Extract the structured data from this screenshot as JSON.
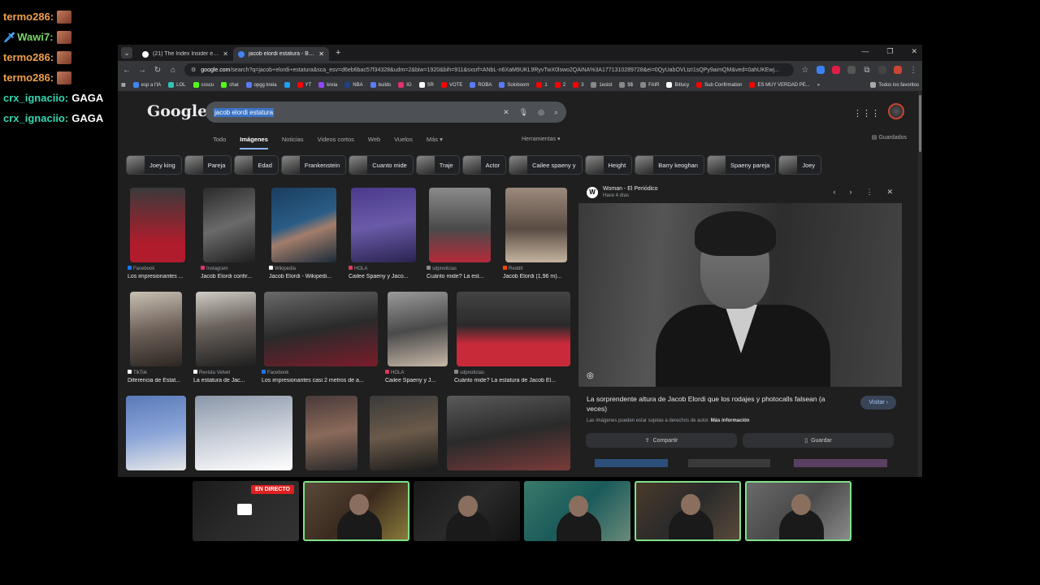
{
  "chat": [
    {
      "user": "termo286:",
      "color": "#f0a04b",
      "msg": ""
    },
    {
      "user": "Wawi7:",
      "color": "#7dd36b",
      "msg": "",
      "badge": "sword-icon"
    },
    {
      "user": "termo286:",
      "color": "#f0a04b",
      "msg": ""
    },
    {
      "user": "termo286:",
      "color": "#f0a04b",
      "msg": ""
    },
    {
      "user": "crx_ignaciio:",
      "color": "#33d6b0",
      "msg": "GAGA"
    },
    {
      "user": "crx_ignaciio:",
      "color": "#33d6b0",
      "msg": "GAGA"
    }
  ],
  "browser": {
    "tabs": [
      {
        "title": "(21) The Index Insider en X: \"Ir...",
        "favicon_color": "#ffffff",
        "active": false
      },
      {
        "title": "jacob elordi estatura - Buscar co...",
        "favicon_color": "#4285f4",
        "active": true
      }
    ],
    "url_host": "google.com",
    "url_rest": "/search?q=jacob+elordi+estatura&sca_esv=d6eb6bac57f34328&udm=2&biw=1920&bih=911&sxsrf=ANbL-n6XaM9UKL9RyvTwX0lswo2QAiNA%3A1771310289728&ei=0QyUabOVLtzI1sQPy9aimQM&ved=0ahUKEwj...",
    "bookmarks": [
      {
        "label": "esp a l'IA",
        "color": "#4285f4"
      },
      {
        "label": "LOL",
        "color": "#2ec4b6"
      },
      {
        "label": "coscu",
        "color": "#53fc18"
      },
      {
        "label": "chat",
        "color": "#53fc18"
      },
      {
        "label": "opgg kreia",
        "color": "#5b7cfa"
      },
      {
        "label": "",
        "color": "#1da1f2"
      },
      {
        "label": "YT",
        "color": "#ff0000"
      },
      {
        "label": "kreia",
        "color": "#9146ff"
      },
      {
        "label": "NBA",
        "color": "#1d428a"
      },
      {
        "label": "builds",
        "color": "#5b7cfa"
      },
      {
        "label": "IG",
        "color": "#e1306c"
      },
      {
        "label": "SR",
        "color": "#ffffff"
      },
      {
        "label": "VOTE",
        "color": "#ff0000"
      },
      {
        "label": "ROBA",
        "color": "#5b7cfa"
      },
      {
        "label": "Soloboom",
        "color": "#5b7cfa"
      },
      {
        "label": "1",
        "color": "#ff0000"
      },
      {
        "label": "2",
        "color": "#ff0000"
      },
      {
        "label": "3",
        "color": "#ff0000"
      },
      {
        "label": "1eslot",
        "color": "#888888"
      },
      {
        "label": "$$",
        "color": "#888888"
      },
      {
        "label": "FAIR",
        "color": "#888888"
      },
      {
        "label": "Bitlucy",
        "color": "#ffffff"
      },
      {
        "label": "Sub Confirmation",
        "color": "#ff0000"
      },
      {
        "label": "ES MUY VERDAD PE...",
        "color": "#ff0000"
      }
    ],
    "bookmarks_more": "»",
    "all_favorites": "Todos los favoritos"
  },
  "google": {
    "logo": "Google",
    "query": "jacob elordi estatura",
    "tabs": [
      "Todo",
      "Imágenes",
      "Noticias",
      "Videos cortos",
      "Web",
      "Vuelos",
      "Más ▾"
    ],
    "active_tab": "Imágenes",
    "tools": "Herramientas ▾",
    "saved": "Guardados",
    "chips": [
      "Joey king",
      "Pareja",
      "Edad",
      "Frankenstein",
      "Cuanto mide",
      "Traje",
      "Actor",
      "Cailee spaeny y",
      "Height",
      "Barry keoghan",
      "Spaeny pareja",
      "Joey"
    ],
    "results": [
      {
        "source": "Facebook",
        "title": "Los impresionantes ...",
        "src_color": "#1877f2"
      },
      {
        "source": "Instagram",
        "title": "Jacob Elordi confir...",
        "src_color": "#e1306c"
      },
      {
        "source": "Wikipedia",
        "title": "Jacob Elordi - Wikipedi...",
        "src_color": "#ffffff"
      },
      {
        "source": "HOLA",
        "title": "Cailee Spaeny y Jaco...",
        "src_color": "#e03a5a"
      },
      {
        "source": "sdpnoticias",
        "title": "Cuánto mide? La est...",
        "src_color": "#888888"
      },
      {
        "source": "Reddit",
        "title": "Jacob Elordi (1,96 m)...",
        "src_color": "#ff4500"
      },
      {
        "source": "TikTok",
        "title": "Diferencia de Estat...",
        "src_color": "#ffffff"
      },
      {
        "source": "Revista Velvet",
        "title": "La estatura de Jac...",
        "src_color": "#ffffff"
      },
      {
        "source": "Facebook",
        "title": "Los impresionantes casi 2 metros de a...",
        "src_color": "#1877f2"
      },
      {
        "source": "HOLA",
        "title": "Cailee Spaeny y J...",
        "src_color": "#e03a5a"
      },
      {
        "source": "sdpnoticias",
        "title": "Cuánto mide? La estatura de Jacob El...",
        "src_color": "#888888"
      }
    ],
    "preview": {
      "source": "Woman - El Periódico",
      "source_icon": "W",
      "date": "Hace 4 días",
      "title": "La sorprendente altura de Jacob Elordi que los rodajes y photocalls falsean (a veces)",
      "visit": "Visitar",
      "note": "Las imágenes pueden estar sujetas a derechos de autor.",
      "note_link": "Más información",
      "share": "Compartir",
      "save": "Guardar"
    }
  },
  "stream": {
    "live_label": "EN DIRECTO"
  }
}
